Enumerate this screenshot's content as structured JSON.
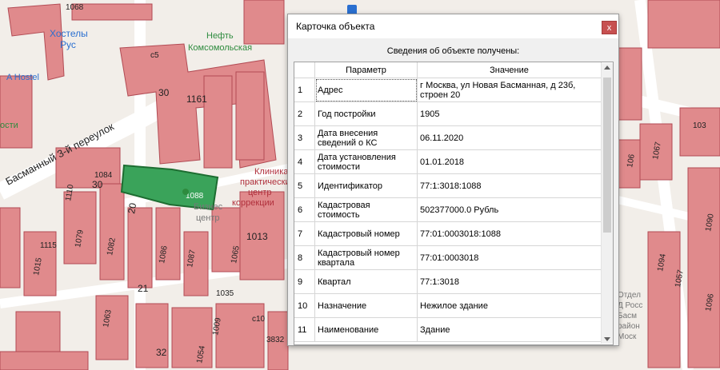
{
  "map": {
    "labels": [
      {
        "text": "1068"
      },
      {
        "text": "Хостелы"
      },
      {
        "text": "Рус"
      },
      {
        "text": "A Hostel"
      },
      {
        "text": "Нефть"
      },
      {
        "text": "Комсомольская"
      },
      {
        "text": "с5"
      },
      {
        "text": "30"
      },
      {
        "text": "1161"
      },
      {
        "text": "ости"
      },
      {
        "text": "Басманный 3-й переулок"
      },
      {
        "text": "1084"
      },
      {
        "text": "30"
      },
      {
        "text": "1110"
      },
      {
        "text": "1088"
      },
      {
        "text": "1115"
      },
      {
        "text": "1015"
      },
      {
        "text": "1079"
      },
      {
        "text": "1082"
      },
      {
        "text": "1086"
      },
      {
        "text": "1087"
      },
      {
        "text": "1013"
      },
      {
        "text": "1065"
      },
      {
        "text": "21"
      },
      {
        "text": "20"
      },
      {
        "text": "1035"
      },
      {
        "text": "1063"
      },
      {
        "text": "1009"
      },
      {
        "text": "с10"
      },
      {
        "text": "32"
      },
      {
        "text": "1054"
      },
      {
        "text": "3832"
      },
      {
        "text": "Клиника"
      },
      {
        "text": "практический"
      },
      {
        "text": "центр"
      },
      {
        "text": "коррекции"
      },
      {
        "text": "Бизнес"
      },
      {
        "text": "центр"
      },
      {
        "text": "103"
      },
      {
        "text": "1067"
      },
      {
        "text": "106"
      },
      {
        "text": "1090"
      },
      {
        "text": "1094"
      },
      {
        "text": "1057"
      },
      {
        "text": "1096"
      },
      {
        "text": "Отдел"
      },
      {
        "text": "Д Росс"
      },
      {
        "text": "Басм"
      },
      {
        "text": "район"
      },
      {
        "text": "Моск"
      }
    ]
  },
  "dialog": {
    "title": "Карточка объекта",
    "close_label": "x",
    "subheader": "Сведения об объекте получены:",
    "columns": {
      "param": "Параметр",
      "value": "Значение"
    },
    "rows": [
      {
        "num": "1",
        "param": "Адрес",
        "value": "г Москва, ул Новая Басманная, д 23б, строен 20"
      },
      {
        "num": "2",
        "param": "Год постройки",
        "value": "1905"
      },
      {
        "num": "3",
        "param": "Дата внесения сведений о КС",
        "value": "06.11.2020"
      },
      {
        "num": "4",
        "param": "Дата установления стоимости",
        "value": "01.01.2018"
      },
      {
        "num": "5",
        "param": "Идентификатор",
        "value": "77:1:3018:1088"
      },
      {
        "num": "6",
        "param": "Кадастровая стоимость",
        "value": "502377000.0 Рубль"
      },
      {
        "num": "7",
        "param": "Кадастровый номер",
        "value": "77:01:0003018:1088"
      },
      {
        "num": "8",
        "param": "Кадастровый номер квартала",
        "value": "77:01:0003018"
      },
      {
        "num": "9",
        "param": "Квартал",
        "value": "77:1:3018"
      },
      {
        "num": "10",
        "param": "Назначение",
        "value": "Нежилое здание"
      },
      {
        "num": "11",
        "param": "Наименование",
        "value": "Здание"
      }
    ]
  },
  "colors": {
    "building": "#e08a8c",
    "highlight": "#3aa35a",
    "road": "#ffffff",
    "map_bg": "#f2eee9"
  }
}
